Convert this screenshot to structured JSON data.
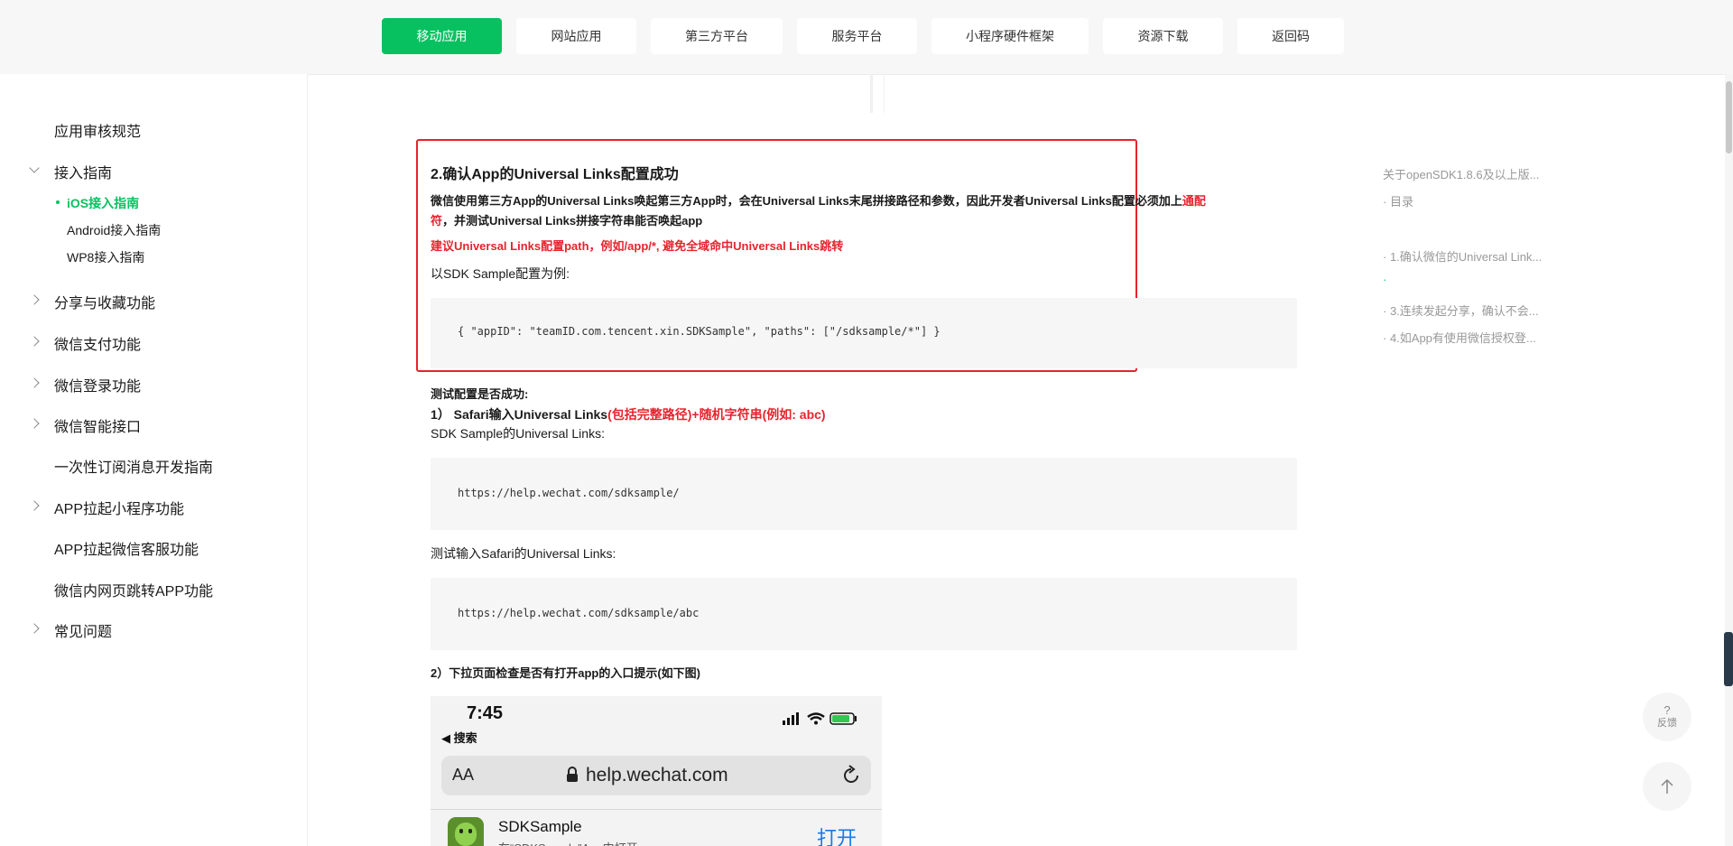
{
  "nav": {
    "tabs": [
      {
        "label": "移动应用",
        "active": true
      },
      {
        "label": "网站应用"
      },
      {
        "label": "第三方平台"
      },
      {
        "label": "服务平台"
      },
      {
        "label": "小程序硬件框架"
      },
      {
        "label": "资源下载"
      },
      {
        "label": "返回码"
      }
    ]
  },
  "sidebar": {
    "items": [
      {
        "label": "应用审核规范",
        "chevron": "none"
      },
      {
        "label": "接入指南",
        "chevron": "down"
      },
      {
        "label": "分享与收藏功能",
        "chevron": "right"
      },
      {
        "label": "微信支付功能",
        "chevron": "right"
      },
      {
        "label": "微信登录功能",
        "chevron": "right"
      },
      {
        "label": "微信智能接口",
        "chevron": "right"
      },
      {
        "label": "一次性订阅消息开发指南",
        "chevron": "none"
      },
      {
        "label": "APP拉起小程序功能",
        "chevron": "right"
      },
      {
        "label": "APP拉起微信客服功能",
        "chevron": "none"
      },
      {
        "label": "微信内网页跳转APP功能",
        "chevron": "none"
      },
      {
        "label": "常见问题",
        "chevron": "right"
      }
    ],
    "sub_items": [
      {
        "label": "iOS接入指南",
        "active": true
      },
      {
        "label": "Android接入指南"
      },
      {
        "label": "WP8接入指南"
      }
    ]
  },
  "main": {
    "heading": "2.确认App的Universal Links配置成功",
    "para1_a": "微信使用第三方App的Universal Links唤起第三方App时，会在Universal Links末尾拼接路径和参数，因此开发者Universal Links配置必须加上",
    "para1_red": "通配",
    "para1_b": "符",
    "para1_c": "，并测试Universal Links拼接字符串能否唤起app",
    "para2": "建议Universal Links配置path，例如/app/*, 避免全域命中Universal Links跳转",
    "para3": "以SDK Sample配置为例:",
    "code1": "{ \"appID\": \"teamID.com.tencent.xin.SDKSample\", \"paths\": [\"/sdksample/*\"] }",
    "test_title": "测试配置是否成功:",
    "step1_prefix": "1）  Safari输入Universal Links",
    "step1_red": "(包括完整路径)+随机字符串(例如: abc)",
    "sample_label": "SDK Sample的Universal Links:",
    "code2": "https://help.wechat.com/sdksample/",
    "test_input_label": "测试输入Safari的Universal Links:",
    "code3": "https://help.wechat.com/sdksample/abc",
    "step2": "2）下拉页面检查是否有打开app的入口提示(如下图)"
  },
  "phone": {
    "time": "7:45",
    "back": "◀ 搜索",
    "aa": "AA",
    "url": "help.wechat.com",
    "app_name": "SDKSample",
    "app_sub": "在“SDKSample”App中打开",
    "open": "打开"
  },
  "toc": {
    "items": [
      "关于openSDK1.8.6及以上版...",
      "· 目录",
      "· 1.确认微信的Universal Link...",
      "·",
      "· 3.连续发起分享，确认不会...",
      "· 4.如App有使用微信授权登..."
    ]
  },
  "float": {
    "feedback": "反馈",
    "question": "?"
  },
  "colors": {
    "accent": "#07c160",
    "red": "#e6232d"
  }
}
